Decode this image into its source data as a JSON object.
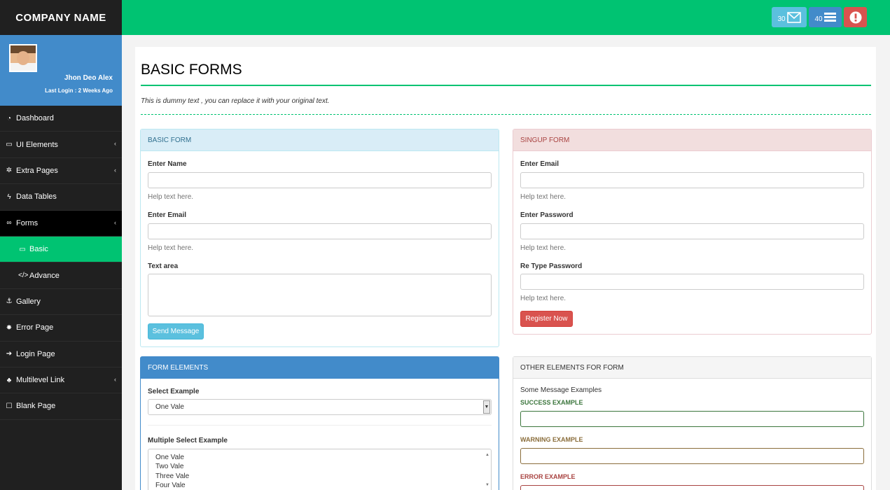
{
  "brand": "COMPANY NAME",
  "topbar": {
    "messages_count": "30",
    "tasks_count": "40"
  },
  "profile": {
    "name": "Jhon Deo Alex",
    "last_login": "Last Login : 2 Weeks Ago"
  },
  "sidebar": {
    "items": [
      {
        "label": "Dashboard",
        "icon": "dashboard-icon"
      },
      {
        "label": "UI Elements",
        "icon": "desktop-icon"
      },
      {
        "label": "Extra Pages",
        "icon": "cogs-icon"
      },
      {
        "label": "Data Tables",
        "icon": "bolt-icon"
      },
      {
        "label": "Forms",
        "icon": "bicycle-icon"
      },
      {
        "label": "Basic",
        "icon": "desktop-icon"
      },
      {
        "label": "Advance",
        "icon": "code-icon"
      },
      {
        "label": "Gallery",
        "icon": "anchor-icon"
      },
      {
        "label": "Error Page",
        "icon": "bug-icon"
      },
      {
        "label": "Login Page",
        "icon": "sign-in-icon"
      },
      {
        "label": "Multilevel Link",
        "icon": "sitemap-icon"
      },
      {
        "label": "Blank Page",
        "icon": "square-icon"
      }
    ]
  },
  "page": {
    "title": "BASIC FORMS",
    "intro": "This is dummy text , you can replace it with your original text."
  },
  "basic_form": {
    "title": "BASIC FORM",
    "name_label": "Enter Name",
    "email_label": "Enter Email",
    "textarea_label": "Text area",
    "help": "Help text here.",
    "send_label": "Send Message"
  },
  "signup_form": {
    "title": "SINGUP FORM",
    "email_label": "Enter Email",
    "password_label": "Enter Password",
    "retype_label": "Re Type Password",
    "help": "Help text here.",
    "register_label": "Register Now"
  },
  "form_elements": {
    "title": "FORM ELEMENTS",
    "select_label": "Select Example",
    "select_value": "One Vale",
    "multi_label": "Multiple Select Example",
    "multi_options": [
      "One Vale",
      "Two Vale",
      "Three Vale",
      "Four Vale"
    ]
  },
  "other_elements": {
    "title": "OTHER ELEMENTS FOR FORM",
    "intro": "Some Message Examples",
    "success_label": "SUCCESS EXAMPLE",
    "warning_label": "WARNING EXAMPLE",
    "error_label": "ERROR EXAMPLE"
  },
  "colors": {
    "accent": "#00c372",
    "sidebar": "#202020",
    "primary": "#428bca",
    "info": "#5bc0de",
    "danger": "#d9534f",
    "success_text": "#3c763d",
    "warning_text": "#8a6d3b",
    "error_text": "#a94442"
  }
}
